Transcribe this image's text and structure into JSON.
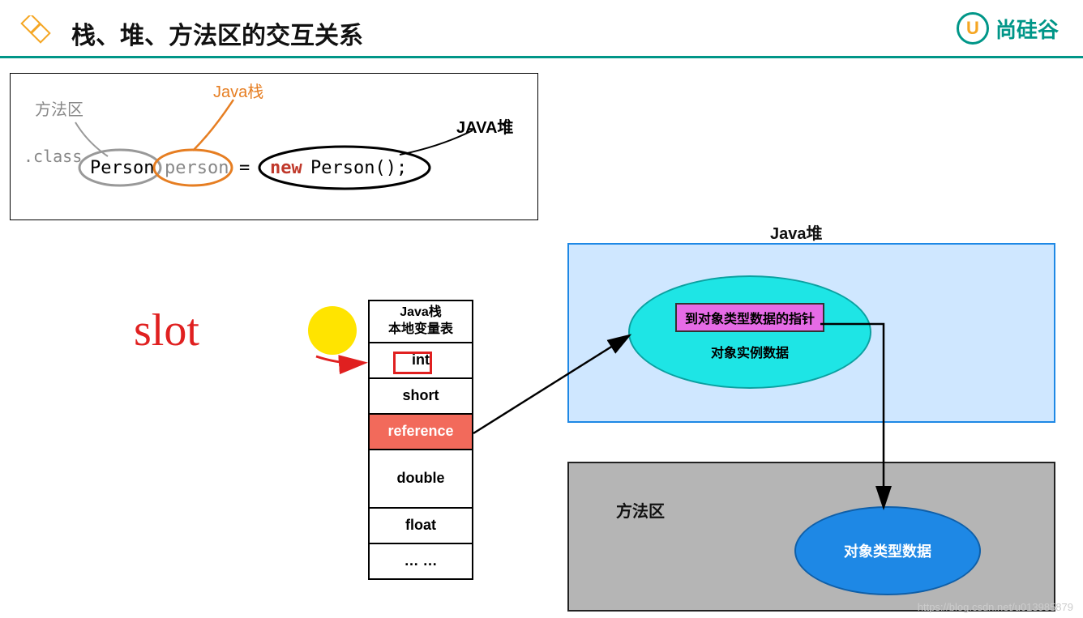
{
  "header": {
    "title": "栈、堆、方法区的交互关系",
    "brand_letter": "U",
    "brand_text": "尚硅谷"
  },
  "code_panel": {
    "method_area_label": "方法区",
    "java_stack_label": "Java栈",
    "java_heap_label": "JAVA堆",
    "class_suffix": ".class",
    "class_name": "Person",
    "var_name": "person",
    "equals": "=",
    "new_kw": "new",
    "ctor": "Person();"
  },
  "heap": {
    "title": "Java堆",
    "pointer_box": "到对象类型数据的指针",
    "instance_data": "对象实例数据"
  },
  "stack_table": {
    "head_line1": "Java栈",
    "head_line2": "本地变量表",
    "rows": [
      "int",
      "short",
      "reference",
      "double",
      "float",
      "… …"
    ]
  },
  "method_area": {
    "label": "方法区",
    "type_data": "对象类型数据"
  },
  "handwriting": {
    "slot": "slot"
  },
  "watermark": "https://blog.csdn.net/u013985879"
}
